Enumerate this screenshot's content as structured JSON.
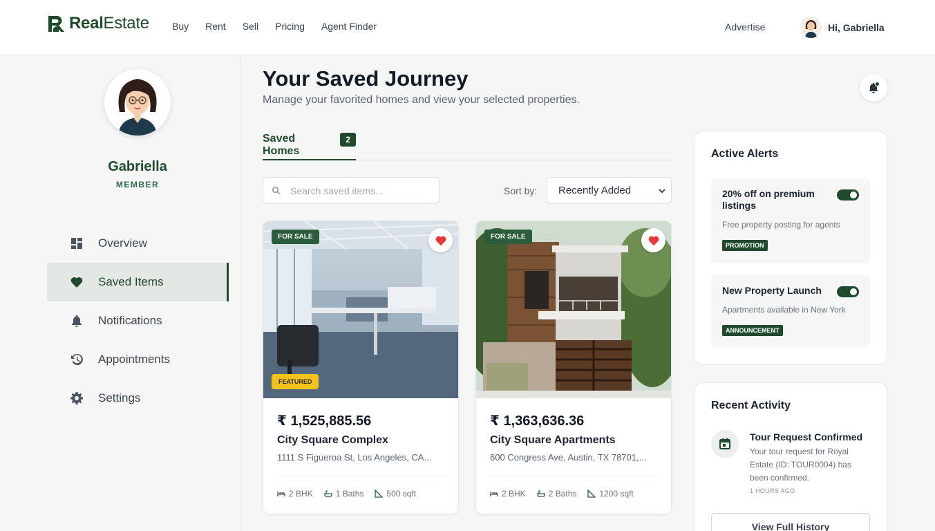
{
  "header": {
    "logo_part1": "Real",
    "logo_part2": "Estate",
    "nav": [
      "Buy",
      "Rent",
      "Sell",
      "Pricing",
      "Agent Finder"
    ],
    "advertise": "Advertise",
    "greeting": "Hi, Gabriella"
  },
  "sidebar": {
    "name": "Gabriella",
    "role": "MEMBER",
    "items": [
      {
        "label": "Overview",
        "icon": "dashboard-icon"
      },
      {
        "label": "Saved Items",
        "icon": "heart-icon"
      },
      {
        "label": "Notifications",
        "icon": "bell-icon"
      },
      {
        "label": "Appointments",
        "icon": "history-icon"
      },
      {
        "label": "Settings",
        "icon": "gear-icon"
      }
    ],
    "active_index": 1
  },
  "main": {
    "title": "Your Saved Journey",
    "subtitle": "Manage your favorited homes and view your selected properties.",
    "tab_label": "Saved Homes",
    "tab_count": "2",
    "search_placeholder": "Search saved items...",
    "sort_label": "Sort by:",
    "sort_value": "Recently Added"
  },
  "cards": [
    {
      "badge": "FOR SALE",
      "featured": "FEATURED",
      "price": "₹ 1,525,885.56",
      "name": "City Square Complex",
      "address": "1111 S Figueroa St, Los Angeles, CA...",
      "bhk": "2 BHK",
      "baths": "1 Baths",
      "area": "500 sqft"
    },
    {
      "badge": "FOR SALE",
      "price": "₹ 1,363,636.36",
      "name": "City Square Apartments",
      "address": "600 Congress Ave, Austin, TX 78701,...",
      "bhk": "2 BHK",
      "baths": "2 Baths",
      "area": "1200 sqft"
    }
  ],
  "alerts": {
    "title": "Active Alerts",
    "items": [
      {
        "title": "20% off on premium listings",
        "desc": "Free property posting for agents",
        "tag": "PROMOTION"
      },
      {
        "title": "New Property Launch",
        "desc": "Apartments available in New York",
        "tag": "ANNOUNCEMENT"
      }
    ]
  },
  "activity": {
    "title": "Recent Activity",
    "item_title": "Tour Request Confirmed",
    "item_desc": "Your tour request for Royal Estate (ID: TOUR0004) has been confirmed.",
    "item_time": "1 HOURS AGO",
    "button": "View Full History"
  },
  "colors": {
    "brand": "#1f4a2c",
    "featured": "#f5c21b",
    "heart": "#e5393a"
  }
}
